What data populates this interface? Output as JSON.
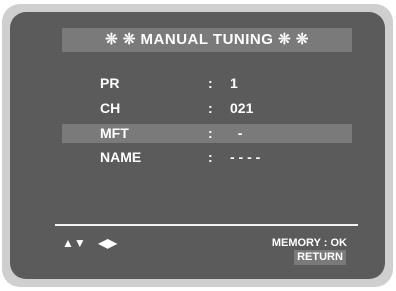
{
  "title": "❊ ❊   MANUAL TUNING   ❊ ❊",
  "rows": [
    {
      "label": "PR",
      "colon": ":",
      "value": "1"
    },
    {
      "label": "CH",
      "colon": ":",
      "value": "021"
    },
    {
      "label": "MFT",
      "colon": ":",
      "value": "  -"
    },
    {
      "label": "NAME",
      "colon": ":",
      "value": "- - - -"
    }
  ],
  "highlighted_row": "MFT",
  "footer": {
    "nav_updown": "▲▼",
    "nav_leftright": "◀▶",
    "memory": "MEMORY : OK",
    "return": "RETURN"
  },
  "colors": {
    "screen_background": "#5b5b5b",
    "highlight_bar": "#7a7a7a",
    "bezel": "#cfcfcf",
    "text": "#ffffff"
  }
}
